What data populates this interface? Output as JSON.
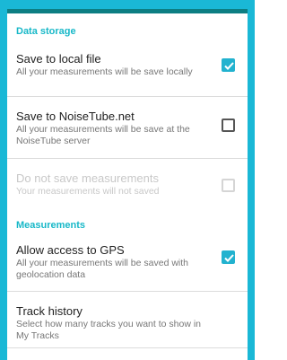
{
  "sections": {
    "data_storage": "Data storage",
    "measurements": "Measurements"
  },
  "items": {
    "save_local": {
      "title": "Save to local file",
      "sub": "All your measurements will be save locally",
      "checked": true
    },
    "save_noisetube": {
      "title": "Save to NoiseTube.net",
      "sub": "All your measurements will be save at the NoiseTube server",
      "checked": false
    },
    "do_not_save": {
      "title": "Do not save measurements",
      "sub": "Your measurements will not saved",
      "checked": false,
      "disabled": true
    },
    "gps": {
      "title": "Allow access to GPS",
      "sub": "All your measurements will be saved with geolocation data",
      "checked": true
    },
    "track_history": {
      "title": "Track history",
      "sub": "Select how many tracks you want to show in My Tracks"
    }
  },
  "colors": {
    "accent": "#1ab8d6",
    "bar": "#0d7e83",
    "section_text": "#18b8c8"
  }
}
